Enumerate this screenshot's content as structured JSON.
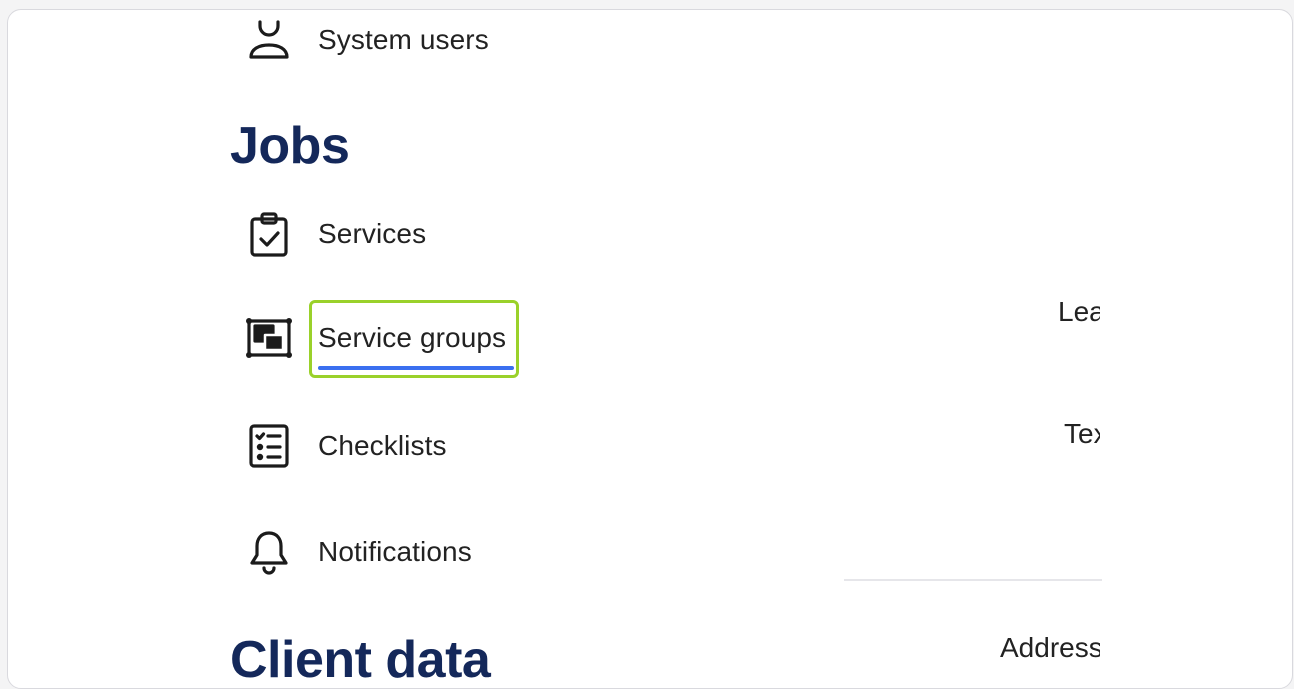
{
  "colors": {
    "heading": "#14285a",
    "text": "#222222",
    "highlight": "#9ad12a",
    "underline": "#3a6ff0",
    "divider": "#e6e6ea"
  },
  "nav": {
    "system_users": {
      "label": "System users",
      "icon": "user-icon"
    },
    "jobs_heading": "Jobs",
    "services": {
      "label": "Services",
      "icon": "clipboard-check-icon"
    },
    "service_groups": {
      "label": "Service groups",
      "icon": "service-group-icon"
    },
    "checklists": {
      "label": "Checklists",
      "icon": "checklist-icon"
    },
    "notifications": {
      "label": "Notifications",
      "icon": "bell-icon"
    },
    "client_data_heading": "Client data"
  },
  "right_panel": {
    "label_1": "Lea",
    "label_2": "Tex",
    "label_3": "Address"
  }
}
